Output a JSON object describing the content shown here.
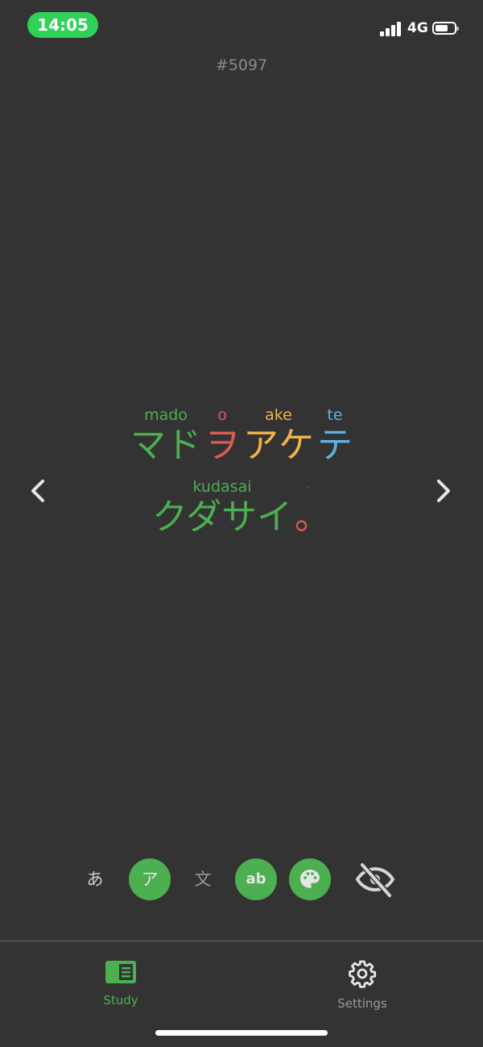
{
  "status": {
    "time": "14:05",
    "network": "4G"
  },
  "card": {
    "number": "#5097"
  },
  "sentence": {
    "line1": [
      {
        "romaji": "mado",
        "kana": "マド",
        "color": "#4caf50"
      },
      {
        "romaji": "o",
        "kana": "ヲ",
        "color": "#e05c4f"
      },
      {
        "romaji": "ake",
        "kana": "アケ",
        "color": "#f0b24a"
      },
      {
        "romaji": "te",
        "kana": "テ",
        "color": "#5ab4e0"
      }
    ],
    "line2": [
      {
        "romaji": "kudasai",
        "kana": "クダサイ",
        "color": "#4caf50"
      },
      {
        "romaji": "·",
        "kana": "。",
        "color": "#e05c4f"
      }
    ]
  },
  "toolbar": {
    "hiragana": "あ",
    "katakana": "ア",
    "kanji": "文",
    "romaji": "ab"
  },
  "tabs": {
    "study": "Study",
    "settings": "Settings"
  },
  "colors": {
    "accent": "#4caf50",
    "background": "#333333"
  }
}
